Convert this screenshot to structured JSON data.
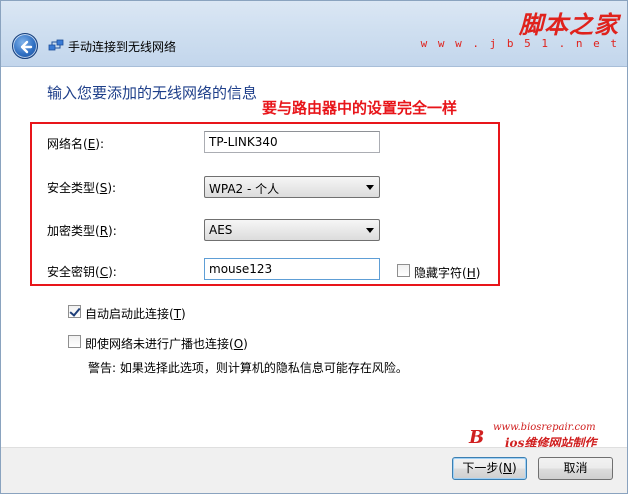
{
  "window": {
    "title": "手动连接到无线网络"
  },
  "watermark": {
    "site_name": "脚本之家",
    "site_url": "w w w . j b 5 1 . n e t",
    "bios_url": "www.biosrepair.com",
    "bios_mark": "B",
    "bios_text": "ios维修网站制作"
  },
  "form": {
    "heading": "输入您要添加的无线网络的信息",
    "annotation": "要与路由器中的设置完全一样",
    "network_name": {
      "label_prefix": "网络名(",
      "accel": "E",
      "label_suffix": "):",
      "value": "TP-LINK340"
    },
    "security_type": {
      "label_prefix": "安全类型(",
      "accel": "S",
      "label_suffix": "):",
      "value": "WPA2 - 个人"
    },
    "encryption_type": {
      "label_prefix": "加密类型(",
      "accel": "R",
      "label_suffix": "):",
      "value": "AES"
    },
    "security_key": {
      "label_prefix": "安全密钥(",
      "accel": "C",
      "label_suffix": "):",
      "value": "mouse123"
    },
    "hide_chars": {
      "label_prefix": "隐藏字符(",
      "accel": "H",
      "label_suffix": ")",
      "checked": false
    },
    "auto_connect": {
      "label_prefix": "自动启动此连接(",
      "accel": "T",
      "label_suffix": ")",
      "checked": true
    },
    "connect_hidden": {
      "label_prefix": "即使网络未进行广播也连接(",
      "accel": "O",
      "label_suffix": ")",
      "checked": false
    },
    "warning": "警告: 如果选择此选项，则计算机的隐私信息可能存在风险。"
  },
  "buttons": {
    "next": {
      "label_prefix": "下一步(",
      "accel": "N",
      "label_suffix": ")"
    },
    "cancel": "取消"
  },
  "colors": {
    "heading": "#1e3f8a",
    "annotation": "#e8151a",
    "watermark": "#e0221c"
  }
}
